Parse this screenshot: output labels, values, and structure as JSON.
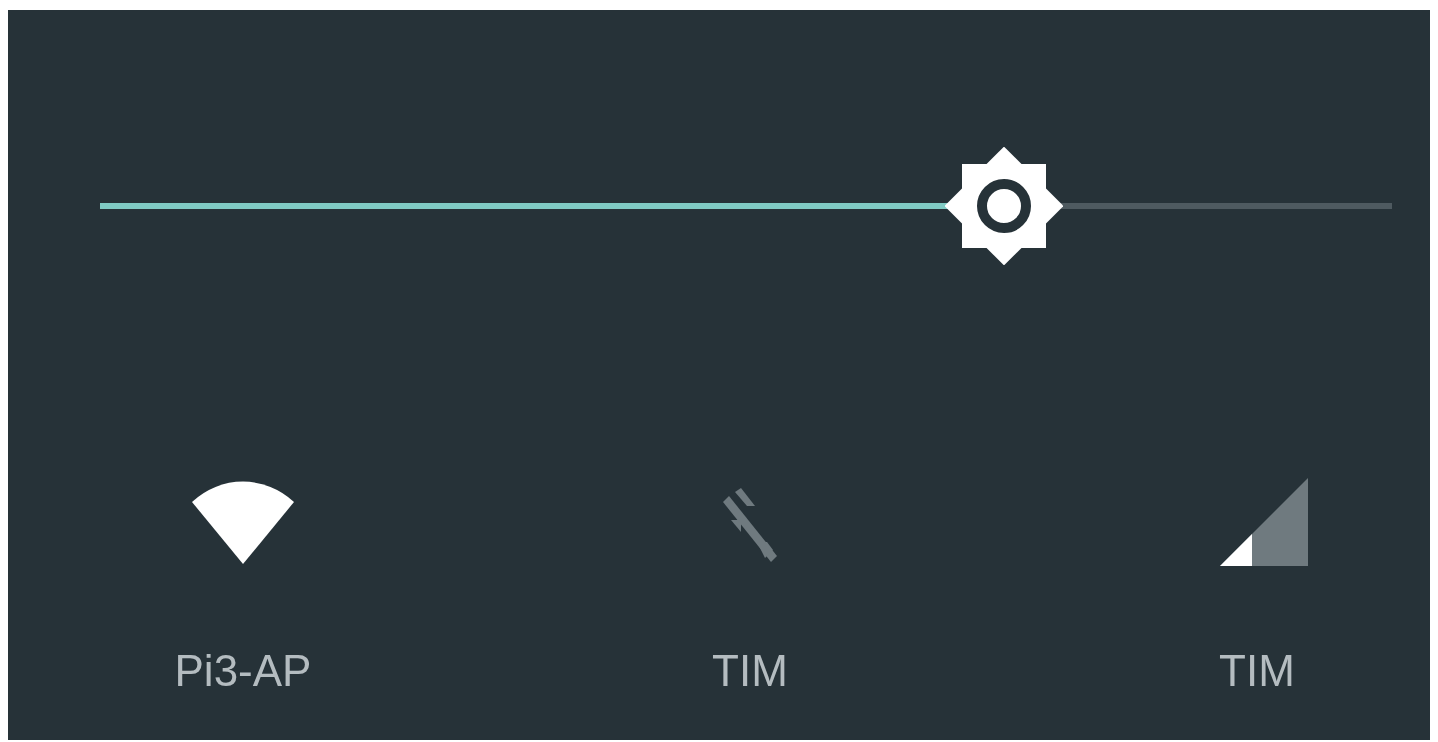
{
  "brightness": {
    "level": 0.7
  },
  "tiles": [
    {
      "kind": "wifi",
      "label": "Pi3-AP",
      "on": true
    },
    {
      "kind": "data",
      "label": "TIM",
      "on": false
    },
    {
      "kind": "cellular",
      "label": "TIM",
      "on": true
    }
  ]
}
